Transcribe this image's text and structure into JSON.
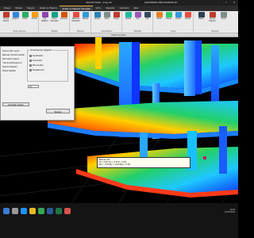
{
  "window": {
    "title": "IdeCAD Statik - proje.ide",
    "title_right": "[ÇEKİRDEK] BETONARME 3D",
    "buttons": [
      "–",
      "□",
      "✕"
    ]
  },
  "tabs": [
    "Dosya",
    "Mimari",
    "Taşıyıcı",
    "Analiz ve Tasarım",
    "Analiz ve Tasarım Sonuçları",
    "Çizim",
    "Raporlar",
    "Görünüm",
    "Ekle"
  ],
  "active_tab": 4,
  "ribbon": {
    "groups": [
      {
        "label": "Sonuç Sunumu",
        "buttons": [
          "Sonuç Seçimi",
          "Düğüm",
          "Kolon",
          "Perde"
        ]
      },
      {
        "label": "Tablolar",
        "buttons": [
          "Kat Bilgileri",
          "Kolon Sonuçları",
          "Çerçeve"
        ]
      },
      {
        "label": "Döşeme",
        "buttons": [
          "Döşeme Sonuçları",
          "Radye"
        ]
      },
      {
        "label": "Görüntüleme",
        "buttons": [
          "Göster",
          "Gizle",
          "Ölçek"
        ]
      },
      {
        "label": "Modeller",
        "buttons": [
          "Model",
          "Kat",
          "Aks"
        ]
      },
      {
        "label": "Detay",
        "buttons": [
          "Kesit",
          "Detay",
          "Kolon",
          "Perde"
        ]
      },
      {
        "label": "Raporlar",
        "buttons": [
          "Rapor",
          "Hesap Raporu",
          "Yazdır"
        ]
      }
    ]
  },
  "section_label": "Analiz Sonuçları",
  "dialog": {
    "left_options": [
      "Sonuç türü seçin",
      "Eleman türünü belirtin",
      "Kat seçimi yapın",
      "Yük kombinasyonu",
      "Sonuç bileşeni",
      "Ölçek faktörü"
    ],
    "group_title": "Gösterilecek değerler",
    "radios": [
      "Gerilmeler",
      "Kuvvetler",
      "Momentler",
      "Deplasman"
    ],
    "selected_radio": 1,
    "number_value": "10",
    "bottom_button": "Sonuçları Göster",
    "ok_label": "Tamam"
  },
  "tooltip": {
    "lines": [
      "Eleman: D1",
      "Kx = 4.87  Ky = -0.32  K = 2.06",
      "Mx = -0.00  My = -0.00  Mxy = 0.00"
    ]
  },
  "taskbar": {
    "apps": [
      "windows-icon",
      "search-icon",
      "edge-icon",
      "explorer-icon",
      "chrome-icon",
      "word-icon",
      "excel-icon",
      "idecad-icon"
    ],
    "app_colors": [
      "#3a7bd5",
      "#999999",
      "#1e90ff",
      "#e8b923",
      "#34a853",
      "#2b579a",
      "#217346",
      "#d9534f"
    ],
    "time": "14:32",
    "date": "12.05.2023"
  },
  "colors": {
    "accent": "#e5b13a",
    "contour_low": "#0a2cff",
    "contour_high": "#ff1e00"
  }
}
